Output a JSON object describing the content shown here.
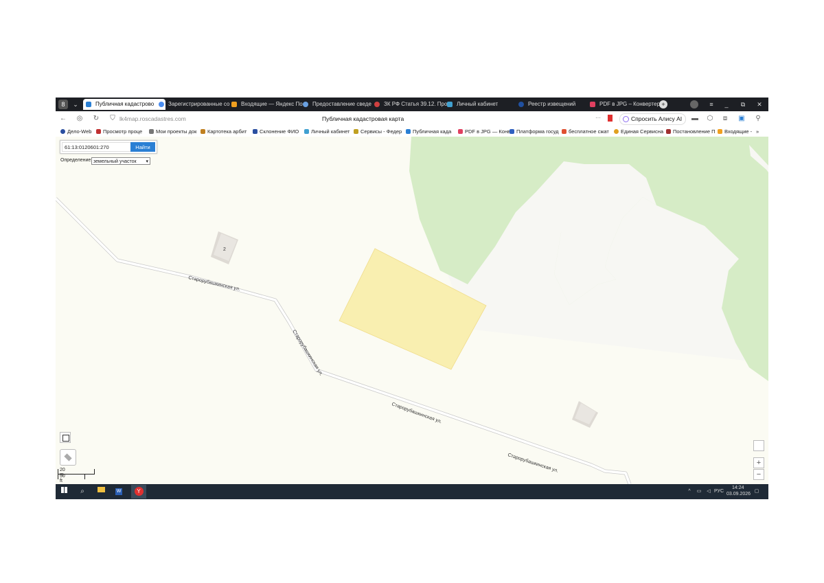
{
  "browser": {
    "tabs": [
      {
        "label": "Публичная кадастрово",
        "active": true,
        "icon": "pkk-icon",
        "color": "#2a7fd4"
      },
      {
        "label": "Зарегистрированные со",
        "active": false,
        "icon": "doc-icon",
        "color": "#4a8df0"
      },
      {
        "label": "Входящие — Яндекс По",
        "active": false,
        "icon": "mail-icon",
        "color": "#f0a020"
      },
      {
        "label": "Предоставление сведе",
        "active": false,
        "icon": "gov-icon",
        "color": "#6aa0e0"
      },
      {
        "label": "ЗК РФ Статья 39.12. Про",
        "active": false,
        "icon": "law-icon",
        "color": "#d04040"
      },
      {
        "label": "Личный кабинет",
        "active": false,
        "icon": "cabinet-icon",
        "color": "#40a0d0"
      },
      {
        "label": "Реестр извещений",
        "active": false,
        "icon": "registry-icon",
        "color": "#2050a0"
      },
      {
        "label": "PDF в JPG – Конвертер F",
        "active": false,
        "icon": "pdf-icon",
        "color": "#e04060"
      }
    ],
    "tab_close": "×",
    "new_tab": "+",
    "url": "lk4map.roscadastres.com",
    "page_title": "Публичная кадастровая карта",
    "more": "···",
    "alice_button": "Спросить Алису AI",
    "bookmarks": [
      {
        "label": "Дело-Web",
        "color": "#2a4fa0"
      },
      {
        "label": "Просмотр проце",
        "color": "#c03030"
      },
      {
        "label": "Мои проекты док",
        "color": "#777777"
      },
      {
        "label": "Картотека арбит",
        "color": "#c08020"
      },
      {
        "label": "Склонение ФИО",
        "color": "#2a4fa0"
      },
      {
        "label": "Личный кабинет",
        "color": "#40a0d0"
      },
      {
        "label": "Сервисы - Федер",
        "color": "#c0a020"
      },
      {
        "label": "Публичная када",
        "color": "#2a7fd4"
      },
      {
        "label": "PDF в JPG — Конв",
        "color": "#e04060"
      },
      {
        "label": "Платформа госуд",
        "color": "#3060c0"
      },
      {
        "label": "бесплатное сжат",
        "color": "#e05030"
      },
      {
        "label": "Единая Сервисна",
        "color": "#e0a020"
      },
      {
        "label": "Постановление П",
        "color": "#a03030"
      },
      {
        "label": "Входящие -",
        "color": "#f0a020"
      }
    ],
    "bookmarks_more": "»"
  },
  "map": {
    "search_value": "61:13:0120601:270",
    "search_button": "Найти",
    "definition_label": "Определение:",
    "definition_value": "земельный участок",
    "building_label": "2",
    "streets": [
      "Старорубашкинская ул.",
      "Старорубашкинская ул.",
      "Старорубашкинская ул.",
      "Старорубашкинская ул."
    ],
    "scale_metric": "20 m",
    "scale_imperial": "50 ft",
    "zoom_in": "+",
    "zoom_out": "−",
    "colors": {
      "forest": "#d6ecc6",
      "parcel": "#f9efb0",
      "road": "#ffffff",
      "building": "#e4e1dc"
    }
  },
  "taskbar": {
    "language": "РУС",
    "time": "14:24",
    "date": "03.09.2026"
  }
}
